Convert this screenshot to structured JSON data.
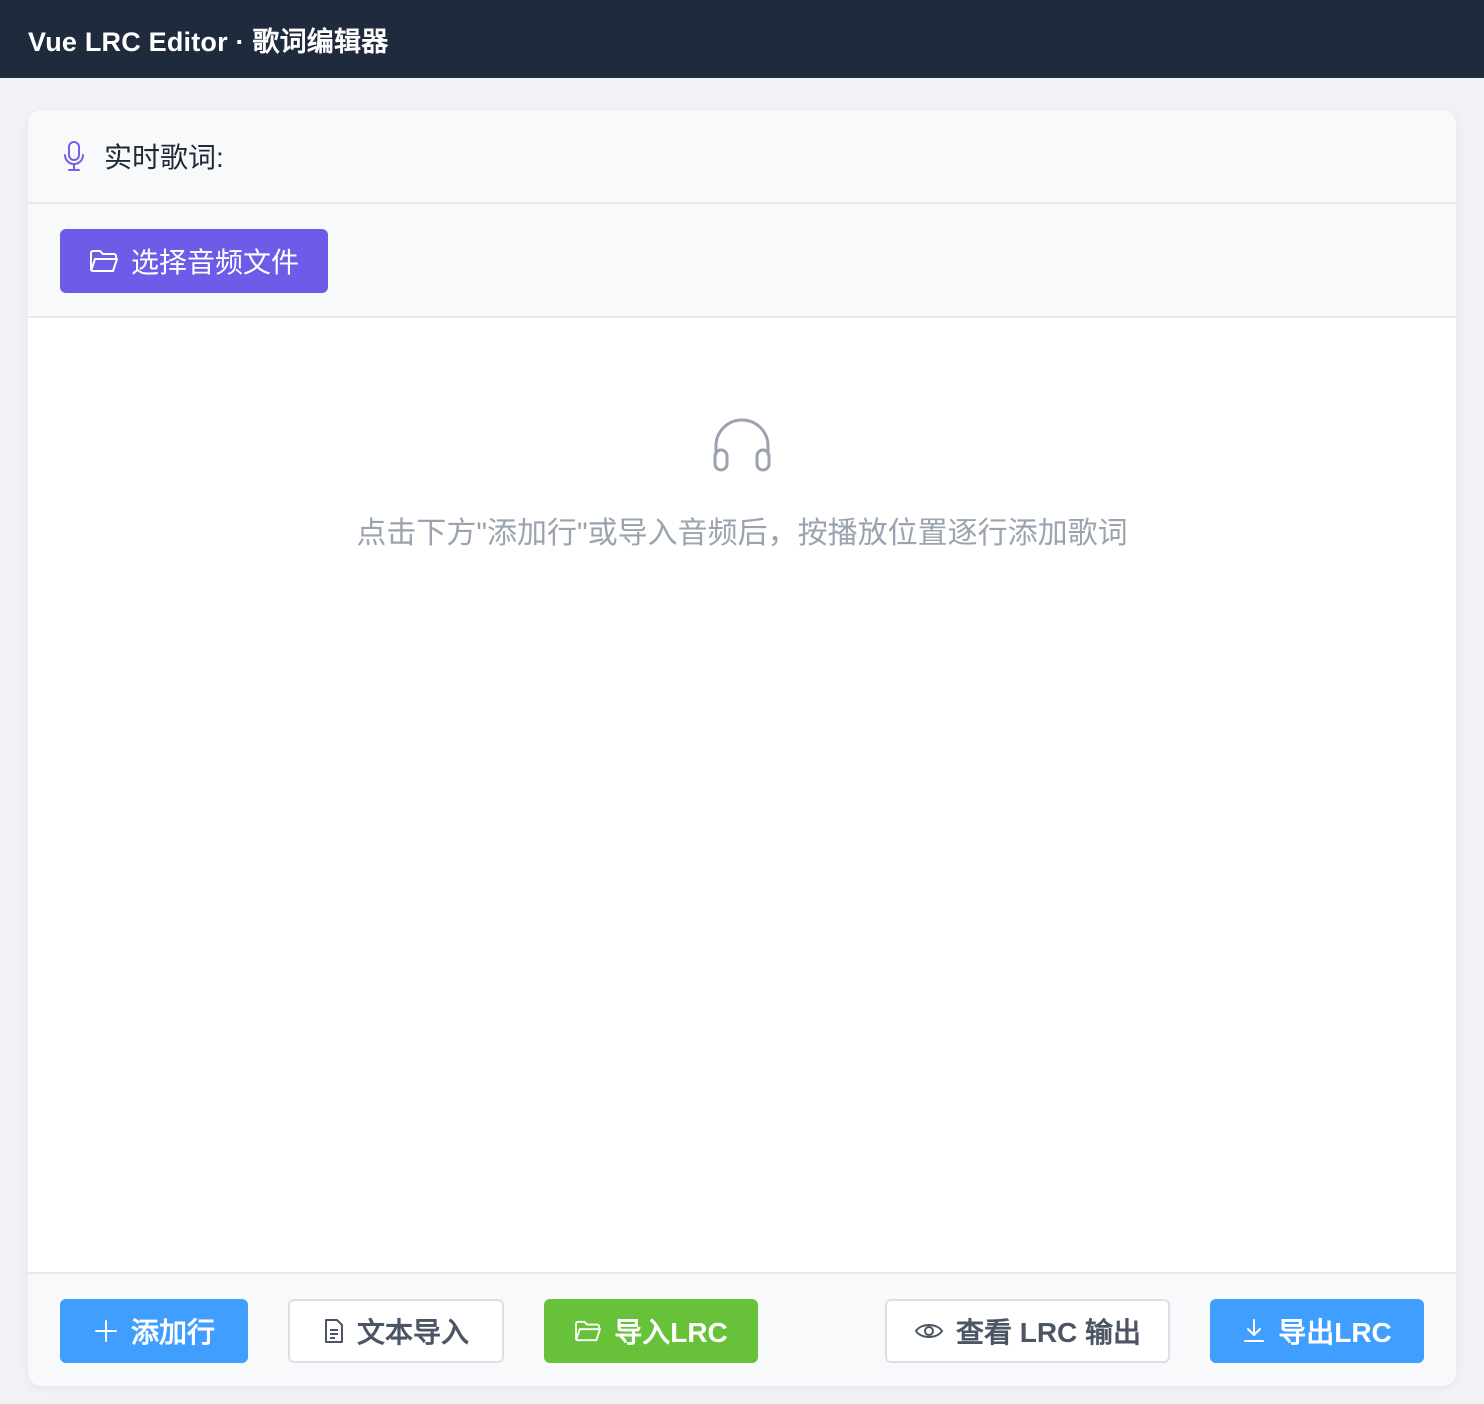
{
  "header": {
    "title": "Vue LRC Editor · 歌词编辑器"
  },
  "lyric_bar": {
    "icon": "microphone-icon",
    "label": "实时歌词:"
  },
  "file_bar": {
    "select_audio_label": "选择音频文件",
    "icon": "folder-open-icon"
  },
  "empty_state": {
    "icon": "headphones-icon",
    "message": "点击下方\"添加行\"或导入音频后，按播放位置逐行添加歌词"
  },
  "toolbar": {
    "add_row_label": "添加行",
    "text_import_label": "文本导入",
    "import_lrc_label": "导入LRC",
    "view_output_label": "查看 LRC 输出",
    "export_lrc_label": "导出LRC"
  },
  "colors": {
    "header_bg": "#1f2a3c",
    "purple": "#6c5ce7",
    "blue": "#409eff",
    "green": "#67c23a",
    "muted_text": "#9aa3ae"
  }
}
